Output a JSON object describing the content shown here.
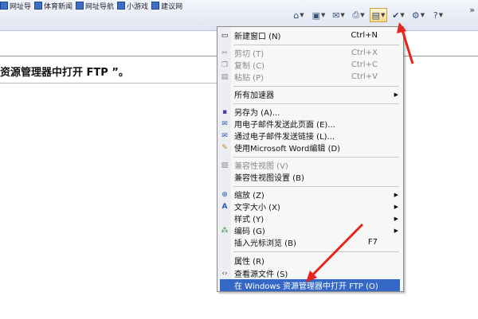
{
  "favorites": [
    {
      "label": "网址导"
    },
    {
      "label": "体育新闻"
    },
    {
      "label": "网址导航"
    },
    {
      "label": "小游戏"
    },
    {
      "label": "建议网"
    }
  ],
  "toolbar": {
    "icons": [
      {
        "name": "home-icon",
        "glyph": "⌂"
      },
      {
        "name": "feeds-icon",
        "glyph": "▣"
      },
      {
        "name": "mail-icon",
        "glyph": "✉"
      },
      {
        "name": "print-icon",
        "glyph": "⎙"
      },
      {
        "name": "page-icon",
        "glyph": "▤"
      },
      {
        "name": "safety-icon",
        "glyph": "✔"
      },
      {
        "name": "tools-icon",
        "glyph": "⚙"
      },
      {
        "name": "help-icon",
        "glyph": "?"
      }
    ],
    "overflow": "»"
  },
  "page": {
    "text": "资源管理器中打开 FTP ”。"
  },
  "menu": {
    "items": [
      {
        "label": "新建窗口 (N)",
        "shortcut": "Ctrl+N",
        "icon": "▭",
        "disabled": false,
        "submenu": false
      },
      {
        "label": "剪切 (T)",
        "shortcut": "Ctrl+X",
        "icon": "✂",
        "disabled": true,
        "submenu": false
      },
      {
        "label": "复制 (C)",
        "shortcut": "Ctrl+C",
        "icon": "❐",
        "disabled": true,
        "submenu": false
      },
      {
        "label": "粘贴 (P)",
        "shortcut": "Ctrl+V",
        "icon": "▤",
        "disabled": true,
        "submenu": false
      },
      {
        "label": "所有加速器",
        "shortcut": "",
        "icon": "",
        "disabled": false,
        "submenu": true
      },
      {
        "label": "另存为 (A)...",
        "shortcut": "",
        "icon": "▪",
        "disabled": false,
        "submenu": false
      },
      {
        "label": "用电子邮件发送此页面 (E)...",
        "shortcut": "",
        "icon": "✉",
        "disabled": false,
        "submenu": false
      },
      {
        "label": "通过电子邮件发送链接 (L)...",
        "shortcut": "",
        "icon": "✉",
        "disabled": false,
        "submenu": false
      },
      {
        "label": "使用Microsoft Word编辑 (D)",
        "shortcut": "",
        "icon": "✎",
        "disabled": false,
        "submenu": false
      },
      {
        "label": "兼容性视图 (V)",
        "shortcut": "",
        "icon": "▧",
        "disabled": true,
        "submenu": false
      },
      {
        "label": "兼容性视图设置 (B)",
        "shortcut": "",
        "icon": "",
        "disabled": false,
        "submenu": false
      },
      {
        "label": "缩放 (Z)",
        "shortcut": "",
        "icon": "⊕",
        "disabled": false,
        "submenu": true
      },
      {
        "label": "文字大小 (X)",
        "shortcut": "",
        "icon": "A",
        "disabled": false,
        "submenu": true
      },
      {
        "label": "样式 (Y)",
        "shortcut": "",
        "icon": "",
        "disabled": false,
        "submenu": true
      },
      {
        "label": "编码 (G)",
        "shortcut": "",
        "icon": "⁂",
        "disabled": false,
        "submenu": true
      },
      {
        "label": "插入光标浏览 (B)",
        "shortcut": "F7",
        "icon": "",
        "disabled": false,
        "submenu": false
      },
      {
        "label": "属性 (R)",
        "shortcut": "",
        "icon": "",
        "disabled": false,
        "submenu": false
      },
      {
        "label": "查看源文件 (S)",
        "shortcut": "",
        "icon": "‹›",
        "disabled": false,
        "submenu": false
      },
      {
        "label": "在 Windows 资源管理器中打开 FTP (O)",
        "shortcut": "",
        "icon": "",
        "disabled": false,
        "submenu": false,
        "highlighted": true
      }
    ]
  },
  "colors": {
    "highlight": "#3467c6",
    "arrow": "#e8231c"
  }
}
